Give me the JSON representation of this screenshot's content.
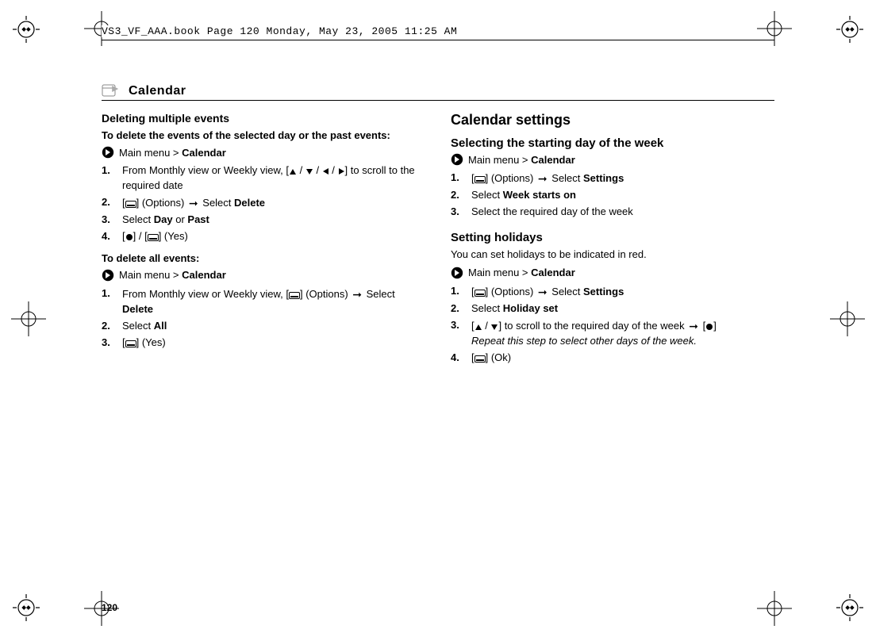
{
  "meta": {
    "running_head": "VS3_VF_AAA.book  Page 120  Monday, May 23, 2005  11:25 AM",
    "page_number": "120"
  },
  "header": {
    "title": "Calendar"
  },
  "left": {
    "title": "Deleting multiple events",
    "intro1": "To delete the events of the selected day or the past events:",
    "crumb1_a": "Main menu > ",
    "crumb1_b": "Calendar",
    "steps1": {
      "s1a": "From Monthly view or Weekly view, [",
      "s1b": "] to scroll to the required date",
      "s2a": "] (Options) ",
      "s2b": " Select ",
      "s2c": "Delete",
      "s3a": "Select ",
      "s3b": "Day",
      "s3c": " or ",
      "s3d": "Past",
      "s4a": "]",
      "s4b": "] (Yes)"
    },
    "intro2": "To delete all events:",
    "crumb2_a": "Main menu > ",
    "crumb2_b": "Calendar",
    "steps2": {
      "s1a": "From Monthly view or Weekly view, [",
      "s1b": "] (Options) ",
      "s1c": "Select ",
      "s1d": "Delete",
      "s2a": "Select ",
      "s2b": "All",
      "s3a": "] (Yes)"
    }
  },
  "right": {
    "title": "Calendar settings",
    "sub1": "Selecting the starting day of the week",
    "crumb1_a": "Main menu > ",
    "crumb1_b": "Calendar",
    "steps1": {
      "s1a": "] (Options) ",
      "s1b": " Select ",
      "s1c": "Settings",
      "s2a": "Select ",
      "s2b": "Week starts on",
      "s3": "Select the required day of the week"
    },
    "sub2": "Setting holidays",
    "body2": "You can set holidays to be indicated in red.",
    "crumb2_a": "Main menu > ",
    "crumb2_b": "Calendar",
    "steps2": {
      "s1a": "] (Options) ",
      "s1b": " Select ",
      "s1c": "Settings",
      "s2a": "Select ",
      "s2b": "Holiday set",
      "s3a": "] to scroll to the required day of the week ",
      "s3b": "]",
      "s3c": "Repeat this step to select other days of the week.",
      "s4a": "] (Ok)"
    }
  }
}
